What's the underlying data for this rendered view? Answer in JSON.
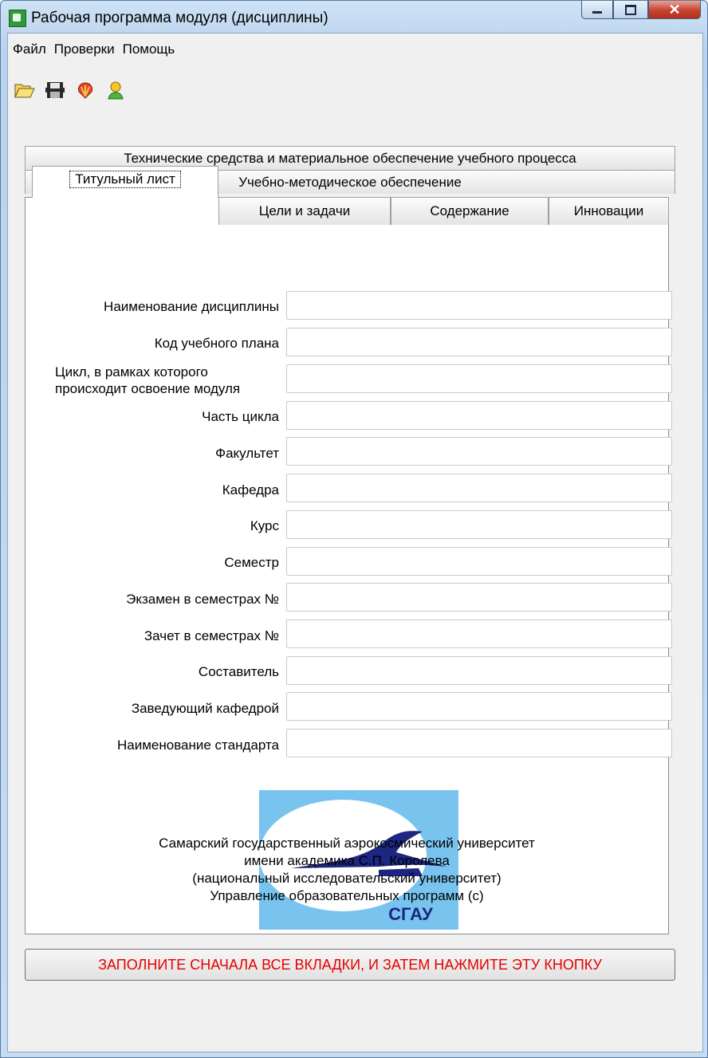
{
  "window": {
    "title": "Рабочая программа модуля (дисциплины)"
  },
  "menu": {
    "items": [
      "Файл",
      "Проверки",
      "Помощь"
    ]
  },
  "toolbar": {
    "icons": [
      "open-folder-icon",
      "save-disk-icon",
      "check-shell-icon",
      "user-icon"
    ]
  },
  "tabs": {
    "row1": "Технические средства и материальное обеспечение учебного процесса",
    "row2": "Учебно-методическое обеспечение",
    "row3": [
      "Титульный лист",
      "Цели и задачи",
      "Содержание",
      "Инновации"
    ],
    "active": "Титульный лист"
  },
  "form": {
    "fields": [
      {
        "label": "Наименование дисциплины",
        "value": ""
      },
      {
        "label": "Код учебного плана",
        "value": ""
      },
      {
        "label_lines": [
          "Цикл, в рамках которого",
          "происходит освоение модуля"
        ],
        "value": ""
      },
      {
        "label": "Часть цикла",
        "value": ""
      },
      {
        "label": "Факультет",
        "value": ""
      },
      {
        "label": "Кафедра",
        "value": ""
      },
      {
        "label": "Курс",
        "value": ""
      },
      {
        "label": "Семестр",
        "value": ""
      },
      {
        "label": "Экзамен в семестрах №",
        "value": ""
      },
      {
        "label": "Зачет в семестрах №",
        "value": ""
      },
      {
        "label": "Составитель",
        "value": ""
      },
      {
        "label": "Заведующий кафедрой",
        "value": ""
      },
      {
        "label": "Наименование стандарта",
        "value": ""
      }
    ]
  },
  "logo": {
    "text": "СГАУ",
    "bg_color": "#78c4ef",
    "ink_color": "#1d2680"
  },
  "org": {
    "lines": [
      "Самарский государственный аэрокосмический университет",
      "имени академика С.П. Королева",
      "(национальный исследовательский университет)",
      "Управление образовательных программ (с)"
    ]
  },
  "submit_button": {
    "label": "ЗАПОЛНИТЕ СНАЧАЛА ВСЕ ВКЛАДКИ, И ЗАТЕМ НАЖМИТЕ ЭТУ КНОПКУ",
    "color": "#e60000"
  }
}
